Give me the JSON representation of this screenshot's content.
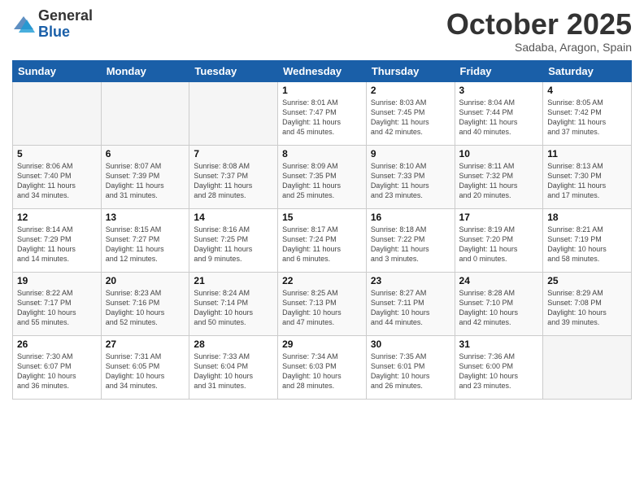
{
  "logo": {
    "general": "General",
    "blue": "Blue"
  },
  "header": {
    "month": "October 2025",
    "location": "Sadaba, Aragon, Spain"
  },
  "days_of_week": [
    "Sunday",
    "Monday",
    "Tuesday",
    "Wednesday",
    "Thursday",
    "Friday",
    "Saturday"
  ],
  "weeks": [
    [
      {
        "day": "",
        "info": ""
      },
      {
        "day": "",
        "info": ""
      },
      {
        "day": "",
        "info": ""
      },
      {
        "day": "1",
        "info": "Sunrise: 8:01 AM\nSunset: 7:47 PM\nDaylight: 11 hours\nand 45 minutes."
      },
      {
        "day": "2",
        "info": "Sunrise: 8:03 AM\nSunset: 7:45 PM\nDaylight: 11 hours\nand 42 minutes."
      },
      {
        "day": "3",
        "info": "Sunrise: 8:04 AM\nSunset: 7:44 PM\nDaylight: 11 hours\nand 40 minutes."
      },
      {
        "day": "4",
        "info": "Sunrise: 8:05 AM\nSunset: 7:42 PM\nDaylight: 11 hours\nand 37 minutes."
      }
    ],
    [
      {
        "day": "5",
        "info": "Sunrise: 8:06 AM\nSunset: 7:40 PM\nDaylight: 11 hours\nand 34 minutes."
      },
      {
        "day": "6",
        "info": "Sunrise: 8:07 AM\nSunset: 7:39 PM\nDaylight: 11 hours\nand 31 minutes."
      },
      {
        "day": "7",
        "info": "Sunrise: 8:08 AM\nSunset: 7:37 PM\nDaylight: 11 hours\nand 28 minutes."
      },
      {
        "day": "8",
        "info": "Sunrise: 8:09 AM\nSunset: 7:35 PM\nDaylight: 11 hours\nand 25 minutes."
      },
      {
        "day": "9",
        "info": "Sunrise: 8:10 AM\nSunset: 7:33 PM\nDaylight: 11 hours\nand 23 minutes."
      },
      {
        "day": "10",
        "info": "Sunrise: 8:11 AM\nSunset: 7:32 PM\nDaylight: 11 hours\nand 20 minutes."
      },
      {
        "day": "11",
        "info": "Sunrise: 8:13 AM\nSunset: 7:30 PM\nDaylight: 11 hours\nand 17 minutes."
      }
    ],
    [
      {
        "day": "12",
        "info": "Sunrise: 8:14 AM\nSunset: 7:29 PM\nDaylight: 11 hours\nand 14 minutes."
      },
      {
        "day": "13",
        "info": "Sunrise: 8:15 AM\nSunset: 7:27 PM\nDaylight: 11 hours\nand 12 minutes."
      },
      {
        "day": "14",
        "info": "Sunrise: 8:16 AM\nSunset: 7:25 PM\nDaylight: 11 hours\nand 9 minutes."
      },
      {
        "day": "15",
        "info": "Sunrise: 8:17 AM\nSunset: 7:24 PM\nDaylight: 11 hours\nand 6 minutes."
      },
      {
        "day": "16",
        "info": "Sunrise: 8:18 AM\nSunset: 7:22 PM\nDaylight: 11 hours\nand 3 minutes."
      },
      {
        "day": "17",
        "info": "Sunrise: 8:19 AM\nSunset: 7:20 PM\nDaylight: 11 hours\nand 0 minutes."
      },
      {
        "day": "18",
        "info": "Sunrise: 8:21 AM\nSunset: 7:19 PM\nDaylight: 10 hours\nand 58 minutes."
      }
    ],
    [
      {
        "day": "19",
        "info": "Sunrise: 8:22 AM\nSunset: 7:17 PM\nDaylight: 10 hours\nand 55 minutes."
      },
      {
        "day": "20",
        "info": "Sunrise: 8:23 AM\nSunset: 7:16 PM\nDaylight: 10 hours\nand 52 minutes."
      },
      {
        "day": "21",
        "info": "Sunrise: 8:24 AM\nSunset: 7:14 PM\nDaylight: 10 hours\nand 50 minutes."
      },
      {
        "day": "22",
        "info": "Sunrise: 8:25 AM\nSunset: 7:13 PM\nDaylight: 10 hours\nand 47 minutes."
      },
      {
        "day": "23",
        "info": "Sunrise: 8:27 AM\nSunset: 7:11 PM\nDaylight: 10 hours\nand 44 minutes."
      },
      {
        "day": "24",
        "info": "Sunrise: 8:28 AM\nSunset: 7:10 PM\nDaylight: 10 hours\nand 42 minutes."
      },
      {
        "day": "25",
        "info": "Sunrise: 8:29 AM\nSunset: 7:08 PM\nDaylight: 10 hours\nand 39 minutes."
      }
    ],
    [
      {
        "day": "26",
        "info": "Sunrise: 7:30 AM\nSunset: 6:07 PM\nDaylight: 10 hours\nand 36 minutes."
      },
      {
        "day": "27",
        "info": "Sunrise: 7:31 AM\nSunset: 6:05 PM\nDaylight: 10 hours\nand 34 minutes."
      },
      {
        "day": "28",
        "info": "Sunrise: 7:33 AM\nSunset: 6:04 PM\nDaylight: 10 hours\nand 31 minutes."
      },
      {
        "day": "29",
        "info": "Sunrise: 7:34 AM\nSunset: 6:03 PM\nDaylight: 10 hours\nand 28 minutes."
      },
      {
        "day": "30",
        "info": "Sunrise: 7:35 AM\nSunset: 6:01 PM\nDaylight: 10 hours\nand 26 minutes."
      },
      {
        "day": "31",
        "info": "Sunrise: 7:36 AM\nSunset: 6:00 PM\nDaylight: 10 hours\nand 23 minutes."
      },
      {
        "day": "",
        "info": ""
      }
    ]
  ]
}
